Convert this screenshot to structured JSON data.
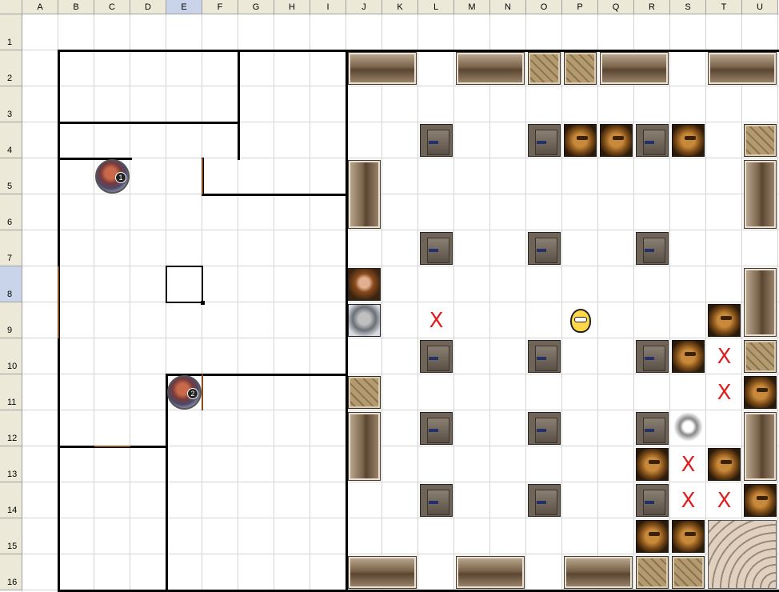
{
  "sheet": {
    "columns": [
      "A",
      "B",
      "C",
      "D",
      "E",
      "F",
      "G",
      "H",
      "I",
      "J",
      "K",
      "L",
      "M",
      "N",
      "O",
      "P",
      "Q",
      "R",
      "S",
      "T",
      "U"
    ],
    "rows": [
      "1",
      "2",
      "3",
      "4",
      "5",
      "6",
      "7",
      "8",
      "9",
      "10",
      "11",
      "12",
      "13",
      "14",
      "15",
      "16"
    ],
    "selected_cell": "E8",
    "selected_column": "E",
    "selected_row": "8"
  },
  "tokens": [
    {
      "name": "bench-horizontal",
      "cell": "J2",
      "span": [
        2,
        1
      ],
      "kind": "bench"
    },
    {
      "name": "bench-horizontal",
      "cell": "M2",
      "span": [
        2,
        1
      ],
      "kind": "bench"
    },
    {
      "name": "crate",
      "cell": "O2",
      "span": [
        1,
        1
      ],
      "kind": "crate"
    },
    {
      "name": "crate",
      "cell": "P2",
      "span": [
        1,
        1
      ],
      "kind": "crate"
    },
    {
      "name": "bench-horizontal",
      "cell": "Q2",
      "span": [
        2,
        1
      ],
      "kind": "bench"
    },
    {
      "name": "bench-horizontal",
      "cell": "T2",
      "span": [
        2,
        1
      ],
      "kind": "bench"
    },
    {
      "name": "stool",
      "cell": "L4",
      "span": [
        1,
        1
      ],
      "kind": "stool"
    },
    {
      "name": "stool",
      "cell": "O4",
      "span": [
        1,
        1
      ],
      "kind": "stool"
    },
    {
      "name": "dwarf-enemy",
      "cell": "P4",
      "span": [
        1,
        1
      ],
      "kind": "dwarf"
    },
    {
      "name": "dwarf-enemy",
      "cell": "Q4",
      "span": [
        1,
        1
      ],
      "kind": "dwarf"
    },
    {
      "name": "stool",
      "cell": "R4",
      "span": [
        1,
        1
      ],
      "kind": "stool"
    },
    {
      "name": "dwarf-enemy",
      "cell": "S4",
      "span": [
        1,
        1
      ],
      "kind": "dwarf"
    },
    {
      "name": "crate",
      "cell": "U4",
      "span": [
        1,
        1
      ],
      "kind": "crate"
    },
    {
      "name": "bench-vertical",
      "cell": "J5",
      "span": [
        1,
        2
      ],
      "kind": "benchv"
    },
    {
      "name": "bench-vertical",
      "cell": "U5",
      "span": [
        1,
        2
      ],
      "kind": "benchv"
    },
    {
      "name": "stool",
      "cell": "L7",
      "span": [
        1,
        1
      ],
      "kind": "stool"
    },
    {
      "name": "stool",
      "cell": "O7",
      "span": [
        1,
        1
      ],
      "kind": "stool"
    },
    {
      "name": "stool",
      "cell": "R7",
      "span": [
        1,
        1
      ],
      "kind": "stool"
    },
    {
      "name": "woman-portrait",
      "cell": "J8",
      "span": [
        1,
        1
      ],
      "kind": "woman"
    },
    {
      "name": "bench-vertical",
      "cell": "U8",
      "span": [
        1,
        2
      ],
      "kind": "benchv"
    },
    {
      "name": "man-portrait",
      "cell": "J9",
      "span": [
        1,
        1
      ],
      "kind": "man"
    },
    {
      "name": "npc-character",
      "cell": "P9",
      "span": [
        1,
        1
      ],
      "kind": "npc"
    },
    {
      "name": "dwarf-enemy",
      "cell": "T9",
      "span": [
        1,
        1
      ],
      "kind": "dwarf"
    },
    {
      "name": "stool",
      "cell": "L10",
      "span": [
        1,
        1
      ],
      "kind": "stool"
    },
    {
      "name": "stool",
      "cell": "O10",
      "span": [
        1,
        1
      ],
      "kind": "stool"
    },
    {
      "name": "stool",
      "cell": "R10",
      "span": [
        1,
        1
      ],
      "kind": "stool"
    },
    {
      "name": "dwarf-enemy",
      "cell": "S10",
      "span": [
        1,
        1
      ],
      "kind": "dwarf"
    },
    {
      "name": "crate",
      "cell": "U10",
      "span": [
        1,
        1
      ],
      "kind": "crate"
    },
    {
      "name": "crate",
      "cell": "J11",
      "span": [
        1,
        1
      ],
      "kind": "crate"
    },
    {
      "name": "dwarf-enemy",
      "cell": "U11",
      "span": [
        1,
        1
      ],
      "kind": "dwarf"
    },
    {
      "name": "bench-vertical",
      "cell": "J12",
      "span": [
        1,
        2
      ],
      "kind": "benchv"
    },
    {
      "name": "stool",
      "cell": "L12",
      "span": [
        1,
        1
      ],
      "kind": "stool"
    },
    {
      "name": "stool",
      "cell": "O12",
      "span": [
        1,
        1
      ],
      "kind": "stool"
    },
    {
      "name": "stool",
      "cell": "R12",
      "span": [
        1,
        1
      ],
      "kind": "stool"
    },
    {
      "name": "wolf-icon",
      "cell": "S12",
      "span": [
        1,
        1
      ],
      "kind": "wolf"
    },
    {
      "name": "bench-vertical",
      "cell": "U12",
      "span": [
        1,
        2
      ],
      "kind": "benchv"
    },
    {
      "name": "dwarf-enemy",
      "cell": "R13",
      "span": [
        1,
        1
      ],
      "kind": "dwarf"
    },
    {
      "name": "dwarf-enemy",
      "cell": "T13",
      "span": [
        1,
        1
      ],
      "kind": "dwarf"
    },
    {
      "name": "stool",
      "cell": "L14",
      "span": [
        1,
        1
      ],
      "kind": "stool"
    },
    {
      "name": "stool",
      "cell": "O14",
      "span": [
        1,
        1
      ],
      "kind": "stool"
    },
    {
      "name": "stool",
      "cell": "R14",
      "span": [
        1,
        1
      ],
      "kind": "stool"
    },
    {
      "name": "dwarf-enemy",
      "cell": "U14",
      "span": [
        1,
        1
      ],
      "kind": "dwarf"
    },
    {
      "name": "dwarf-enemy",
      "cell": "R15",
      "span": [
        1,
        1
      ],
      "kind": "dwarf"
    },
    {
      "name": "dwarf-enemy",
      "cell": "S15",
      "span": [
        1,
        1
      ],
      "kind": "dwarf"
    },
    {
      "name": "stairs",
      "cell": "T15",
      "span": [
        2,
        2
      ],
      "kind": "stairs"
    },
    {
      "name": "bench-horizontal",
      "cell": "J16",
      "span": [
        2,
        1
      ],
      "kind": "bench"
    },
    {
      "name": "bench-horizontal",
      "cell": "M16",
      "span": [
        2,
        1
      ],
      "kind": "bench"
    },
    {
      "name": "bench-horizontal",
      "cell": "P16",
      "span": [
        2,
        1
      ],
      "kind": "bench"
    },
    {
      "name": "crate",
      "cell": "R16",
      "span": [
        1,
        1
      ],
      "kind": "crate"
    },
    {
      "name": "crate",
      "cell": "S16",
      "span": [
        1,
        1
      ],
      "kind": "crate"
    }
  ],
  "heroes": [
    {
      "cell": "C5",
      "badge": "1"
    },
    {
      "cell": "E11",
      "badge": "2"
    }
  ],
  "marks": [
    {
      "cell": "L9",
      "text": "X"
    },
    {
      "cell": "T10",
      "text": "X"
    },
    {
      "cell": "T11",
      "text": "X"
    },
    {
      "cell": "S13",
      "text": "X"
    },
    {
      "cell": "S14",
      "text": "X"
    },
    {
      "cell": "T14",
      "text": "X"
    }
  ]
}
